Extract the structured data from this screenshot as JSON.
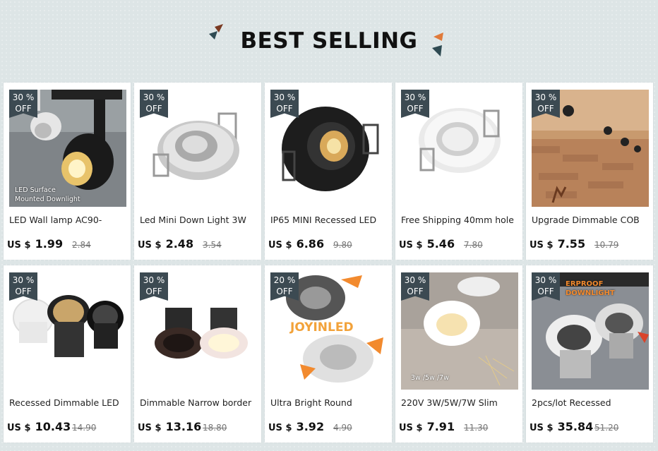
{
  "section": {
    "title": "BEST SELLING"
  },
  "products": [
    {
      "badge": [
        "30 %",
        "OFF"
      ],
      "name": "LED Wall lamp AC90-",
      "currency": "US $",
      "price": "1.99",
      "old_price": "2.84",
      "image_caption": "LED Surface\nMounted Downlight",
      "image": "wall-lamp"
    },
    {
      "badge": [
        "30 %",
        "OFF"
      ],
      "name": "Led Mini Down Light 3W",
      "currency": "US $",
      "price": "2.48",
      "old_price": "3.54",
      "image_caption": "",
      "image": "mini-silver"
    },
    {
      "badge": [
        "30 %",
        "OFF"
      ],
      "name": "IP65 MINI Recessed LED",
      "currency": "US $",
      "price": "6.86",
      "old_price": "9.80",
      "image_caption": "",
      "image": "black-recessed"
    },
    {
      "badge": [
        "30 %",
        "OFF"
      ],
      "name": "Free Shipping 40mm hole",
      "currency": "US $",
      "price": "5.46",
      "old_price": "7.80",
      "image_caption": "",
      "image": "white-round"
    },
    {
      "badge": [
        "30 %",
        "OFF"
      ],
      "name": "Upgrade Dimmable COB",
      "currency": "US $",
      "price": "7.55",
      "old_price": "10.79",
      "image_caption": "",
      "image": "room"
    },
    {
      "badge": [
        "30 %",
        "OFF"
      ],
      "name": "Recessed Dimmable LED",
      "currency": "US $",
      "price": "10.43",
      "old_price": "14.90",
      "image_caption": "",
      "image": "three-cob"
    },
    {
      "badge": [
        "30 %",
        "OFF"
      ],
      "name": "Dimmable Narrow border",
      "currency": "US $",
      "price": "13.16",
      "old_price": "18.80",
      "image_caption": "",
      "image": "two-cob"
    },
    {
      "badge": [
        "20 %",
        "OFF"
      ],
      "name": "Ultra Bright Round",
      "currency": "US $",
      "price": "3.92",
      "old_price": "4.90",
      "image_caption": "JOYINLED",
      "image": "joyin"
    },
    {
      "badge": [
        "30 %",
        "OFF"
      ],
      "name": "220V 3W/5W/7W Slim",
      "currency": "US $",
      "price": "7.91",
      "old_price": "11.30",
      "image_caption": "3w /5w /7w",
      "image": "slim"
    },
    {
      "badge": [
        "30 %",
        "OFF"
      ],
      "name": "2pcs/lot Recessed",
      "currency": "US $",
      "price": "35.84",
      "old_price": "51.20",
      "image_caption": "ERPROOF DOWNLIGHT",
      "image": "waterproof"
    }
  ],
  "colors": {
    "badge": "#3c4a52",
    "accent_orange": "#e07a3a",
    "accent_dark": "#2e4a52"
  }
}
